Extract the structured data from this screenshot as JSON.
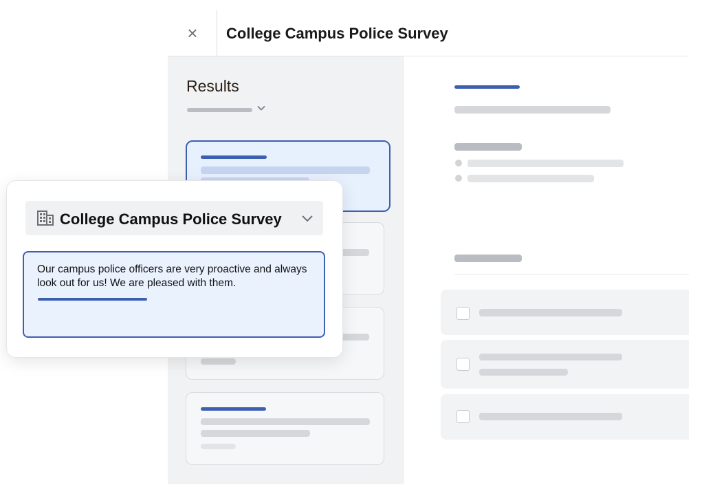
{
  "window": {
    "title": "College Campus Police Survey",
    "close_glyph": "×"
  },
  "sidebar": {
    "heading": "Results",
    "dropdown_chevron": "⌄"
  },
  "popup": {
    "survey_select": {
      "label": "College Campus Police Survey",
      "icon": "building-icon"
    },
    "response": {
      "text": "Our campus police officers are very proactive and always look out for us! We are pleased with them."
    }
  },
  "colors": {
    "accent": "#3d5fb0",
    "selected_card_bg": "#e7f0fd",
    "sidebar_bg": "#f1f2f4"
  }
}
